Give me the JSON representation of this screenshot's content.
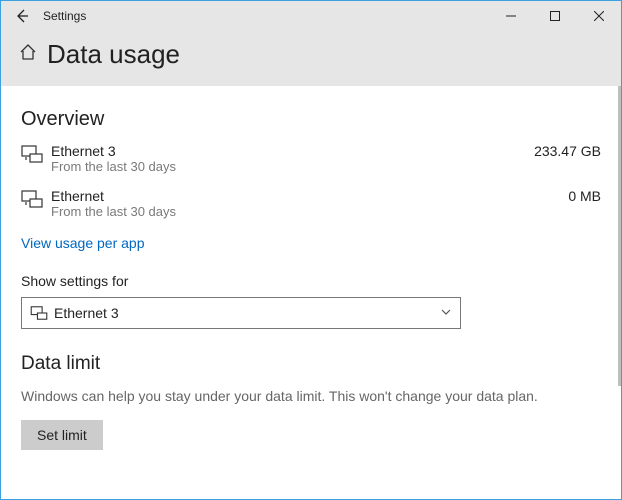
{
  "window": {
    "title": "Settings"
  },
  "header": {
    "page_title": "Data usage"
  },
  "overview": {
    "heading": "Overview",
    "items": [
      {
        "name": "Ethernet 3",
        "subtitle": "From the last 30 days",
        "value": "233.47 GB"
      },
      {
        "name": "Ethernet",
        "subtitle": "From the last 30 days",
        "value": "0 MB"
      }
    ],
    "link": "View usage per app"
  },
  "settings_for": {
    "label": "Show settings for",
    "selected": "Ethernet 3"
  },
  "data_limit": {
    "heading": "Data limit",
    "description": "Windows can help you stay under your data limit. This won't change your data plan.",
    "button": "Set limit"
  },
  "colors": {
    "accent": "#0067c0",
    "border": "#3aa0e0"
  }
}
